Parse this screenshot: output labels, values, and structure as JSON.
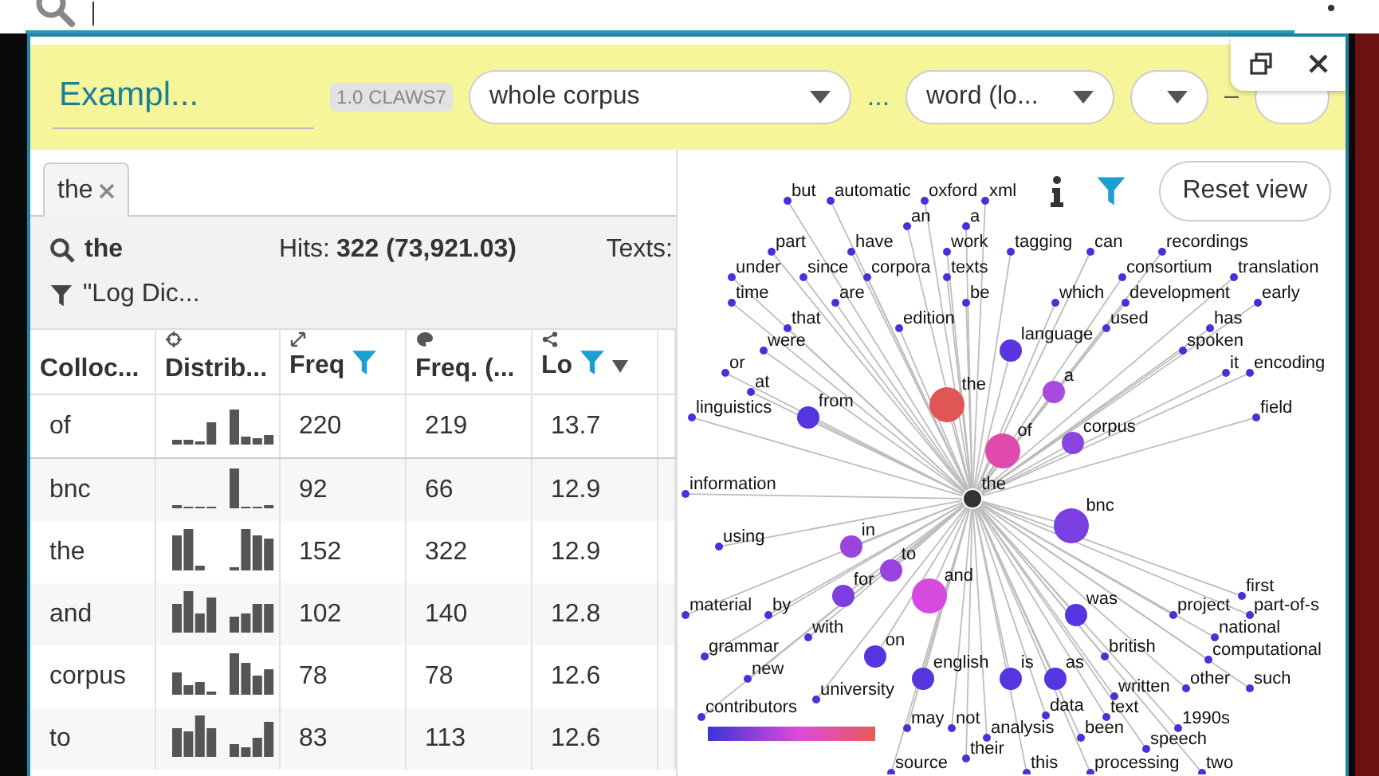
{
  "panel": {
    "title": "Exampl...",
    "badge": "1.0 CLAWS7",
    "corpus_select": "whole corpus",
    "ellipsis": "...",
    "attribute_select": "word (lo...",
    "separator": "–"
  },
  "tabs": [
    {
      "label": "the",
      "selected": true
    }
  ],
  "query": {
    "term": "the",
    "hits_label": "Hits:",
    "hits_value": "322 (73,921.03)",
    "texts_label": "Texts:",
    "filter": "\"Log Dic..."
  },
  "table": {
    "columns": [
      {
        "label": "Colloc...",
        "filter": false,
        "sorted": false
      },
      {
        "label": "Distrib...",
        "filter": false,
        "sorted": false
      },
      {
        "label": "Freq",
        "filter": true,
        "sorted": false
      },
      {
        "label": "Freq. (...",
        "filter": false,
        "sorted": false
      },
      {
        "label": "Lo",
        "filter": true,
        "sorted": true
      }
    ],
    "rows": [
      {
        "collocate": "of",
        "freq": "220",
        "freq_2": "219",
        "column_5": "13.7"
      },
      {
        "collocate": "bnc",
        "freq": "92",
        "freq_2": "66",
        "column_5": "12.9"
      },
      {
        "collocate": "the",
        "freq": "152",
        "freq_2": "322",
        "column_5": "12.9"
      },
      {
        "collocate": "and",
        "freq": "102",
        "freq_2": "140",
        "column_5": "12.8"
      },
      {
        "collocate": "corpus",
        "freq": "78",
        "freq_2": "78",
        "column_5": "12.6"
      },
      {
        "collocate": "to",
        "freq": "83",
        "freq_2": "113",
        "column_5": "12.6"
      }
    ]
  },
  "graph": {
    "reset_label": "Reset view",
    "nodes": [
      {
        "label": "but",
        "kind": "small",
        "color": "#4b2fd8"
      },
      {
        "label": "automatic",
        "kind": "small",
        "color": "#4b2fd8"
      },
      {
        "label": "oxford",
        "kind": "small",
        "color": "#4b2fd8"
      },
      {
        "label": "xml",
        "kind": "small",
        "color": "#4b2fd8"
      },
      {
        "label": "an",
        "kind": "small",
        "color": "#4b2fd8"
      },
      {
        "label": "a",
        "kind": "small",
        "color": "#4b2fd8"
      },
      {
        "label": "part",
        "kind": "small",
        "color": "#4b2fd8"
      },
      {
        "label": "have",
        "kind": "small",
        "color": "#4b2fd8"
      },
      {
        "label": "work",
        "kind": "small",
        "color": "#4b2fd8"
      },
      {
        "label": "tagging",
        "kind": "small",
        "color": "#4b2fd8"
      },
      {
        "label": "can",
        "kind": "small",
        "color": "#4b2fd8"
      },
      {
        "label": "recordings",
        "kind": "small",
        "color": "#4b2fd8"
      },
      {
        "label": "under",
        "kind": "small",
        "color": "#4b2fd8"
      },
      {
        "label": "since",
        "kind": "small",
        "color": "#4b2fd8"
      },
      {
        "label": "corpora",
        "kind": "small",
        "color": "#4b2fd8"
      },
      {
        "label": "texts",
        "kind": "small",
        "color": "#4b2fd8"
      },
      {
        "label": "consortium",
        "kind": "small",
        "color": "#4b2fd8"
      },
      {
        "label": "translation",
        "kind": "small",
        "color": "#4b2fd8"
      },
      {
        "label": "time",
        "kind": "small",
        "color": "#4b2fd8"
      },
      {
        "label": "are",
        "kind": "small",
        "color": "#4b2fd8"
      },
      {
        "label": "be",
        "kind": "small",
        "color": "#4b2fd8"
      },
      {
        "label": "which",
        "kind": "small",
        "color": "#4b2fd8"
      },
      {
        "label": "development",
        "kind": "small",
        "color": "#4b2fd8"
      },
      {
        "label": "early",
        "kind": "small",
        "color": "#4b2fd8"
      },
      {
        "label": "that",
        "kind": "small",
        "color": "#4b2fd8"
      },
      {
        "label": "edition",
        "kind": "small",
        "color": "#4b2fd8"
      },
      {
        "label": "used",
        "kind": "small",
        "color": "#4b2fd8"
      },
      {
        "label": "has",
        "kind": "small",
        "color": "#4b2fd8"
      },
      {
        "label": "were",
        "kind": "small",
        "color": "#4b2fd8"
      },
      {
        "label": "language",
        "kind": "medium",
        "color": "#5b36e0"
      },
      {
        "label": "spoken",
        "kind": "small",
        "color": "#4b2fd8"
      },
      {
        "label": "or",
        "kind": "small",
        "color": "#4b2fd8"
      },
      {
        "label": "it",
        "kind": "small",
        "color": "#4b2fd8"
      },
      {
        "label": "encoding",
        "kind": "small",
        "color": "#4b2fd8"
      },
      {
        "label": "at",
        "kind": "small",
        "color": "#4b2fd8"
      },
      {
        "label": "a",
        "kind": "medium",
        "color": "#a64ae0"
      },
      {
        "label": "the",
        "kind": "large",
        "color": "#e05555"
      },
      {
        "label": "linguistics",
        "kind": "small",
        "color": "#4b2fd8"
      },
      {
        "label": "from",
        "kind": "medium",
        "color": "#5535e0"
      },
      {
        "label": "field",
        "kind": "small",
        "color": "#4b2fd8"
      },
      {
        "label": "corpus",
        "kind": "medium",
        "color": "#8a44e0"
      },
      {
        "label": "of",
        "kind": "large",
        "color": "#e04aad"
      },
      {
        "label": "information",
        "kind": "small",
        "color": "#4b2fd8"
      },
      {
        "label": "the",
        "kind": "center",
        "color": "#333333"
      },
      {
        "label": "bnc",
        "kind": "large",
        "color": "#7a3fe0"
      },
      {
        "label": "using",
        "kind": "small",
        "color": "#4b2fd8"
      },
      {
        "label": "in",
        "kind": "medium",
        "color": "#9a44e0"
      },
      {
        "label": "to",
        "kind": "medium",
        "color": "#9a44e0"
      },
      {
        "label": "for",
        "kind": "medium",
        "color": "#7f3fe0"
      },
      {
        "label": "and",
        "kind": "large",
        "color": "#d74ae0"
      },
      {
        "label": "first",
        "kind": "small",
        "color": "#4b2fd8"
      },
      {
        "label": "material",
        "kind": "small",
        "color": "#4b2fd8"
      },
      {
        "label": "by",
        "kind": "small",
        "color": "#4b2fd8"
      },
      {
        "label": "was",
        "kind": "medium",
        "color": "#5535e0"
      },
      {
        "label": "project",
        "kind": "small",
        "color": "#4b2fd8"
      },
      {
        "label": "part-of-s",
        "kind": "small",
        "color": "#4b2fd8"
      },
      {
        "label": "with",
        "kind": "small",
        "color": "#4b2fd8"
      },
      {
        "label": "national",
        "kind": "small",
        "color": "#4b2fd8"
      },
      {
        "label": "grammar",
        "kind": "small",
        "color": "#4b2fd8"
      },
      {
        "label": "on",
        "kind": "medium",
        "color": "#5535e0"
      },
      {
        "label": "british",
        "kind": "small",
        "color": "#4b2fd8"
      },
      {
        "label": "computational",
        "kind": "small",
        "color": "#4b2fd8"
      },
      {
        "label": "new",
        "kind": "small",
        "color": "#4b2fd8"
      },
      {
        "label": "english",
        "kind": "medium",
        "color": "#5535e0"
      },
      {
        "label": "is",
        "kind": "medium",
        "color": "#5535e0"
      },
      {
        "label": "as",
        "kind": "medium",
        "color": "#5535e0"
      },
      {
        "label": "other",
        "kind": "small",
        "color": "#4b2fd8"
      },
      {
        "label": "such",
        "kind": "small",
        "color": "#4b2fd8"
      },
      {
        "label": "university",
        "kind": "small",
        "color": "#4b2fd8"
      },
      {
        "label": "written",
        "kind": "small",
        "color": "#4b2fd8"
      },
      {
        "label": "contributors",
        "kind": "small",
        "color": "#4b2fd8"
      },
      {
        "label": "data",
        "kind": "small",
        "color": "#4b2fd8"
      },
      {
        "label": "text",
        "kind": "small",
        "color": "#4b2fd8"
      },
      {
        "label": "may",
        "kind": "small",
        "color": "#4b2fd8"
      },
      {
        "label": "not",
        "kind": "small",
        "color": "#4b2fd8"
      },
      {
        "label": "1990s",
        "kind": "small",
        "color": "#4b2fd8"
      },
      {
        "label": "analysis",
        "kind": "small",
        "color": "#4b2fd8"
      },
      {
        "label": "been",
        "kind": "small",
        "color": "#4b2fd8"
      },
      {
        "label": "speech",
        "kind": "small",
        "color": "#4b2fd8"
      },
      {
        "label": "their",
        "kind": "small",
        "color": "#4b2fd8"
      },
      {
        "label": "source",
        "kind": "small",
        "color": "#4b2fd8"
      },
      {
        "label": "this",
        "kind": "small",
        "color": "#4b2fd8"
      },
      {
        "label": "processing",
        "kind": "small",
        "color": "#4b2fd8"
      },
      {
        "label": "two",
        "kind": "small",
        "color": "#4b2fd8"
      }
    ]
  }
}
